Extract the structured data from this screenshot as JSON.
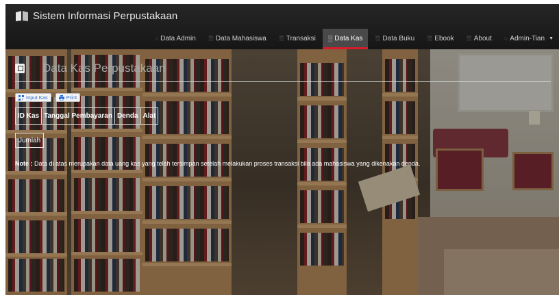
{
  "navbar": {
    "brand_title": "Sistem Informasi Perpustakaan",
    "brand_icon": "book-icon",
    "items": [
      {
        "label": "Data Admin",
        "icon": "user-icon"
      },
      {
        "label": "Data Mahasiswa",
        "icon": "list-icon"
      },
      {
        "label": "Transaksi",
        "icon": "list-icon"
      },
      {
        "label": "Data Kas",
        "icon": "chart-icon",
        "active": true
      },
      {
        "label": "Data Buku",
        "icon": "list-icon"
      },
      {
        "label": "Ebook",
        "icon": "list-icon"
      },
      {
        "label": "About",
        "icon": "list-icon"
      },
      {
        "label": "Admin-Tian",
        "icon": "user-icon"
      }
    ],
    "active_color": "#d81b2a"
  },
  "page": {
    "title": "Data Kas Perpustakaan",
    "buttons": {
      "input_kas": "Input Kas",
      "print": "Print"
    },
    "table": {
      "headers": [
        "ID Kas",
        "Tanggal Pembayaran",
        "Denda",
        "Alat"
      ]
    },
    "jumlah_label": "Jumlah",
    "note_label": "Note :",
    "note_text": "Data di atas merupakan data uang kas yang telah tersimpan setelah melakukan proses transaksi bila ada mahasiswa yang dikenakan denda."
  }
}
